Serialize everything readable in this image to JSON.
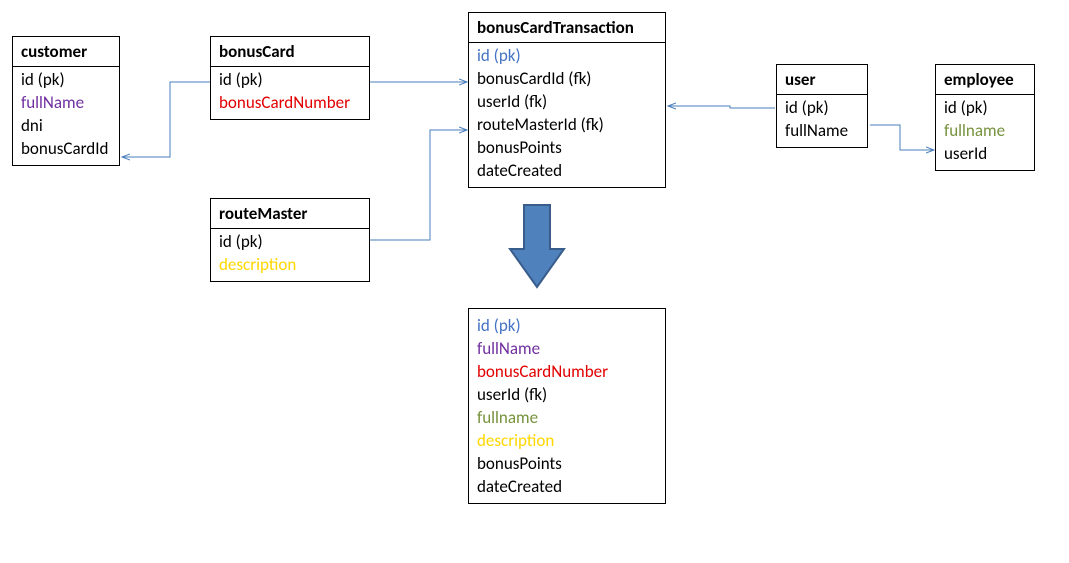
{
  "colors": {
    "arrowStroke": "#4a7ebb",
    "arrowFill": "#4f81bd",
    "arrowFillDark": "#385d8a"
  },
  "entities": {
    "customer": {
      "title": "customer",
      "fields": [
        {
          "text": "id (pk)",
          "color": "black"
        },
        {
          "text": "fullName",
          "color": "purple"
        },
        {
          "text": "dni",
          "color": "black"
        },
        {
          "text": "bonusCardId",
          "color": "black"
        }
      ]
    },
    "bonusCard": {
      "title": "bonusCard",
      "fields": [
        {
          "text": "id  (pk)",
          "color": "black"
        },
        {
          "text": "bonusCardNumber",
          "color": "red"
        }
      ]
    },
    "bonusCardTransaction": {
      "title": "bonusCardTransaction",
      "fields": [
        {
          "text": "id (pk)",
          "color": "blue"
        },
        {
          "text": "bonusCardId (fk)",
          "color": "black"
        },
        {
          "text": "userId (fk)",
          "color": "black"
        },
        {
          "text": "routeMasterId (fk)",
          "color": "black"
        },
        {
          "text": "bonusPoints",
          "color": "black"
        },
        {
          "text": "dateCreated",
          "color": "black"
        }
      ]
    },
    "user": {
      "title": "user",
      "fields": [
        {
          "text": "id (pk)",
          "color": "black"
        },
        {
          "text": "fullName",
          "color": "black"
        }
      ]
    },
    "employee": {
      "title": "employee",
      "fields": [
        {
          "text": "id (pk)",
          "color": "black"
        },
        {
          "text": "fullname",
          "color": "olive"
        },
        {
          "text": "userId",
          "color": "black"
        }
      ]
    },
    "routeMaster": {
      "title": "routeMaster",
      "fields": [
        {
          "text": "id (pk)",
          "color": "black"
        },
        {
          "text": "description",
          "color": "yellow"
        }
      ]
    },
    "result": {
      "fields": [
        {
          "text": "id (pk)",
          "color": "blue"
        },
        {
          "text": "fullName",
          "color": "purple"
        },
        {
          "text": "bonusCardNumber",
          "color": "red"
        },
        {
          "text": "userId (fk)",
          "color": "black"
        },
        {
          "text": "fullname",
          "color": "olive"
        },
        {
          "text": "description",
          "color": "yellow"
        },
        {
          "text": "bonusPoints",
          "color": "black"
        },
        {
          "text": "dateCreated",
          "color": "black"
        }
      ]
    }
  }
}
